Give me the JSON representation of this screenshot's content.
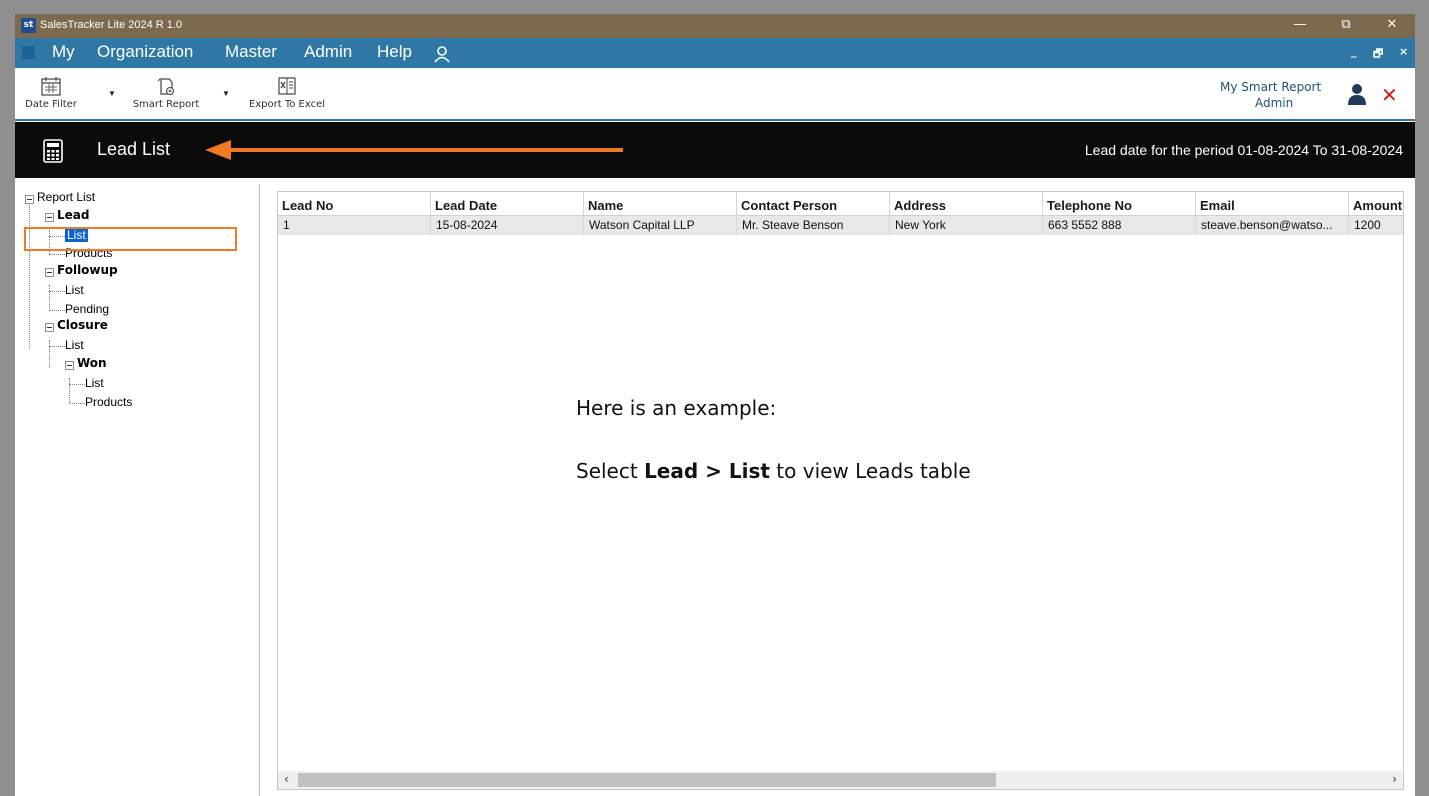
{
  "window": {
    "title": "SalesTracker Lite 2024 R 1.0",
    "logo_text": "st",
    "minimize": "—",
    "restore": "⧉",
    "close": "✕"
  },
  "menubar": {
    "items": [
      "My",
      "Organization",
      "Master",
      "Admin",
      "Help"
    ],
    "person_icon": "person-icon",
    "mdi_minimize": "_",
    "mdi_restore": "🗗",
    "mdi_close": "×"
  },
  "toolbar": {
    "date_filter": "Date Filter",
    "smart_report": "Smart Report",
    "export_excel": "Export To Excel",
    "my_smart_report": "My Smart Report",
    "user_name": "Admin"
  },
  "header": {
    "title": "Lead List",
    "period": "Lead date for the period 01-08-2024 To 31-08-2024"
  },
  "tree": {
    "root": "Report List",
    "lead": "Lead",
    "lead_list": "List",
    "lead_products": "Products",
    "followup": "Followup",
    "followup_list": "List",
    "followup_pending": "Pending",
    "closure": "Closure",
    "closure_list": "List",
    "won": "Won",
    "won_list": "List",
    "won_products": "Products"
  },
  "table": {
    "columns": [
      "Lead No",
      "Lead Date",
      "Name",
      "Contact Person",
      "Address",
      "Telephone No",
      "Email",
      "Amount"
    ],
    "rows": [
      [
        "1",
        "15-08-2024",
        "Watson Capital LLP",
        "Mr. Steave Benson",
        "New York",
        "663 5552 888",
        "steave.benson@watso...",
        "1200"
      ]
    ]
  },
  "annotation": {
    "line1": "Here is an example:",
    "line2_prefix": "Select ",
    "line2_bold": "Lead > List",
    "line2_suffix": " to view Leads table"
  },
  "colors": {
    "titlebar": "#7b6a4e",
    "menubar": "#2f78a6",
    "header": "#0b0b0b",
    "highlight": "#f07a22",
    "selection": "#0a64d6"
  }
}
